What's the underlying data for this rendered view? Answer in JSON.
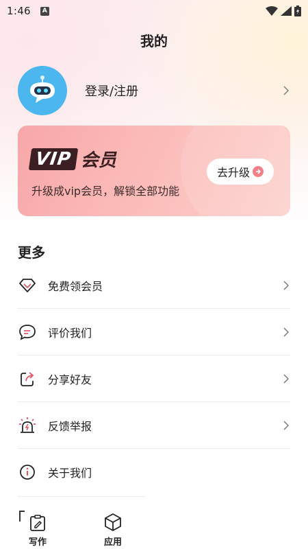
{
  "status_bar": {
    "time": "1:46",
    "notification_badge": "A"
  },
  "header": {
    "title": "我的"
  },
  "profile": {
    "login_label": "登录/注册"
  },
  "vip_card": {
    "badge_text": "VIP",
    "member_text": "会员",
    "description": "升级成vip会员，解锁全部功能",
    "upgrade_label": "去升级"
  },
  "more": {
    "title": "更多",
    "items": [
      {
        "label": "免费领会员",
        "icon": "diamond-icon"
      },
      {
        "label": "评价我们",
        "icon": "chat-bubble-icon"
      },
      {
        "label": "分享好友",
        "icon": "share-icon"
      },
      {
        "label": "反馈举报",
        "icon": "alarm-icon"
      },
      {
        "label": "关于我们",
        "icon": "info-icon"
      }
    ]
  },
  "bottom_nav": {
    "items": [
      {
        "label": "写作",
        "icon": "edit-clipboard-icon"
      },
      {
        "label": "应用",
        "icon": "cube-icon"
      }
    ]
  },
  "colors": {
    "vip_accent": "#3b1f22",
    "arrow_accent": "#f27f86",
    "avatar_bg": "#4bb7ee"
  }
}
